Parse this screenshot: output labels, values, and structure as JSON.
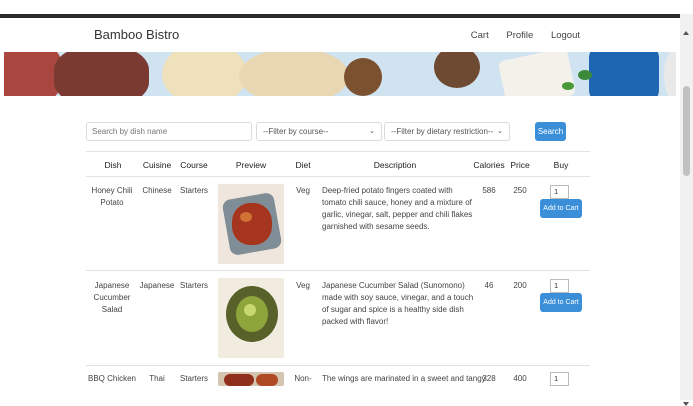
{
  "nav": {
    "brand": "Bamboo Bistro",
    "links": [
      "Cart",
      "Profile",
      "Logout"
    ]
  },
  "filters": {
    "search_placeholder": "Search by dish name",
    "course_select": "--Filter by course--",
    "diet_select": "--Filter by dietary restriction--",
    "search_button": "Search"
  },
  "table": {
    "headers": [
      "Dish",
      "Cuisine",
      "Course",
      "Preview",
      "Diet",
      "Description",
      "Calories",
      "Price",
      "Buy"
    ],
    "add_to_cart_label": "Add to Cart",
    "rows": [
      {
        "dish": "Honey Chili Potato",
        "cuisine": "Chinese",
        "course": "Starters",
        "diet": "Veg",
        "description": "Deep-fried potato fingers coated with tomato chili sauce, honey and a mixture of garlic, vinegar, salt, pepper and chili flakes garnished with sesame seeds.",
        "calories": "586",
        "price": "250",
        "qty": "1"
      },
      {
        "dish": "Japanese Cucumber Salad",
        "cuisine": "Japanese",
        "course": "Starters",
        "diet": "Veg",
        "description": "Japanese Cucumber Salad (Sunomono) made with soy sauce, vinegar, and a touch of sugar and spice is a healthy side dish packed with flavor!",
        "calories": "46",
        "price": "200",
        "qty": "1"
      },
      {
        "dish": "BBQ Chicken",
        "cuisine": "Thai",
        "course": "Starters",
        "diet": "Non-",
        "description": "The wings are marinated in a sweet and tangy",
        "calories": "328",
        "price": "400",
        "qty": "1"
      }
    ]
  }
}
